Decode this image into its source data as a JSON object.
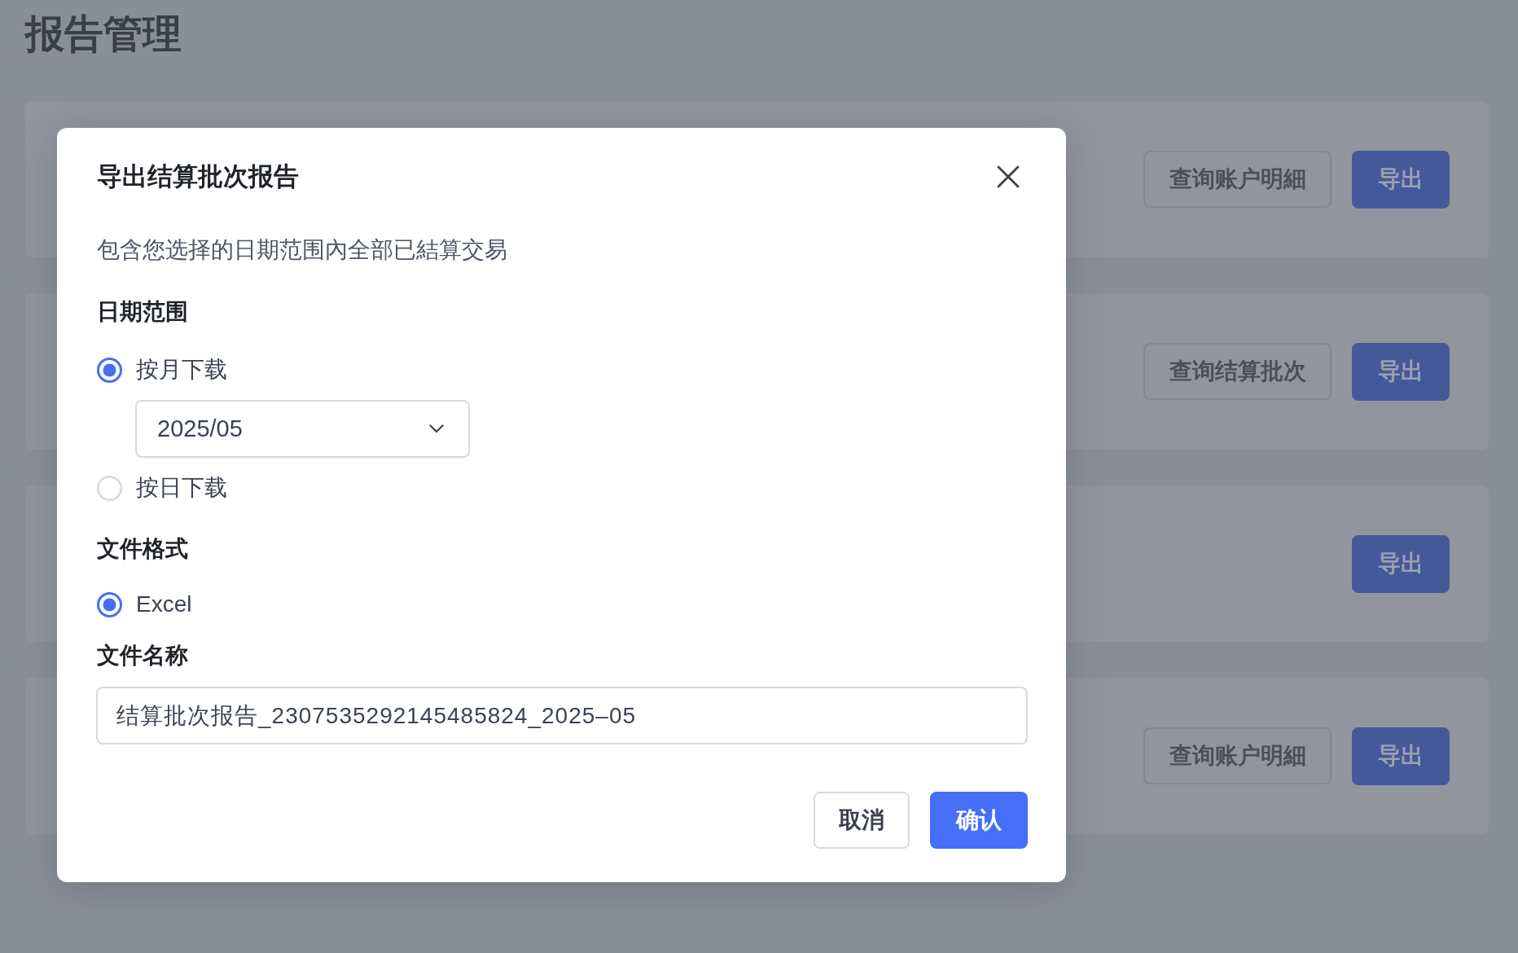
{
  "page": {
    "title": "报告管理"
  },
  "report_cards": [
    {
      "actions": [
        {
          "label": "查询账户明細",
          "kind": "outline"
        },
        {
          "label": "导出",
          "kind": "primary"
        }
      ]
    },
    {
      "actions": [
        {
          "label": "查询结算批次",
          "kind": "outline"
        },
        {
          "label": "导出",
          "kind": "primary"
        }
      ]
    },
    {
      "actions": [
        {
          "label": "导出",
          "kind": "primary"
        }
      ]
    },
    {
      "actions": [
        {
          "label": "查询账户明細",
          "kind": "outline"
        },
        {
          "label": "导出",
          "kind": "primary"
        }
      ]
    }
  ],
  "dialog": {
    "title": "导出结算批次报告",
    "description": "包含您选择的日期范围內全部已結算交易",
    "date_range": {
      "label": "日期范围",
      "options": [
        {
          "label": "按月下载",
          "selected": true,
          "month_select": {
            "value": "2025/05"
          }
        },
        {
          "label": "按日下载",
          "selected": false
        }
      ]
    },
    "file_format": {
      "label": "文件格式",
      "options": [
        {
          "label": "Excel",
          "selected": true
        }
      ]
    },
    "file_name": {
      "label": "文件名称",
      "value": "结算批次报告_2307535292145485824_2025–05"
    },
    "buttons": [
      {
        "label": "取消",
        "kind": "outline"
      },
      {
        "label": "确认",
        "kind": "primary"
      }
    ]
  }
}
